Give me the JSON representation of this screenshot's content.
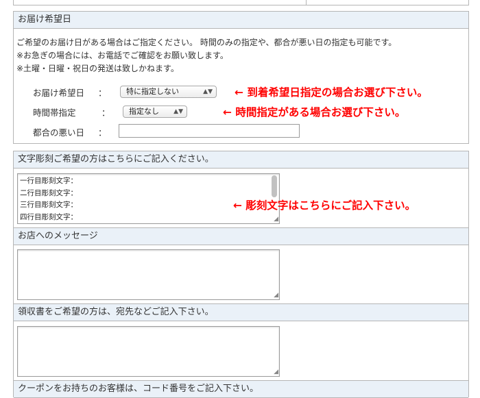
{
  "delivery": {
    "title": "お届け希望日",
    "intro_lines": [
      "ご希望のお届け日がある場合はご指定ください。 時間のみの指定や、都合が悪い日の指定も可能です。",
      "※お急ぎの場合には、お電話でご確認をお願い致します。",
      "※土曜・日曜・祝日の発送は致しかねます。"
    ],
    "date_label": "お届け希望日",
    "date_value": "特に指定しない",
    "date_note": "← 到着希望日指定の場合お選び下さい。",
    "time_label": "時間帯指定",
    "time_value": "指定なし",
    "time_note": "← 時間指定がある場合お選び下さい。",
    "bad_day_label": "都合の悪い日",
    "colon": "："
  },
  "engraving": {
    "title": "文字彫刻ご希望の方はこちらにご記入ください。",
    "lines": [
      "一行目彫刻文字：",
      "二行目彫刻文字：",
      "三行目彫刻文字：",
      "四行目彫刻文字："
    ],
    "note": "← 彫刻文字はこちらにご記入下さい。"
  },
  "message": {
    "title": "お店へのメッセージ"
  },
  "receipt": {
    "title": "領収書をご希望の方は、宛先などご記入下さい。"
  },
  "coupon": {
    "title": "クーポンをお持ちのお客様は、コード番号をご記入下さい。"
  },
  "colors": {
    "note_red": "#ff0000",
    "header_bg": "#eaf1f8",
    "border": "#b5b5b5"
  }
}
